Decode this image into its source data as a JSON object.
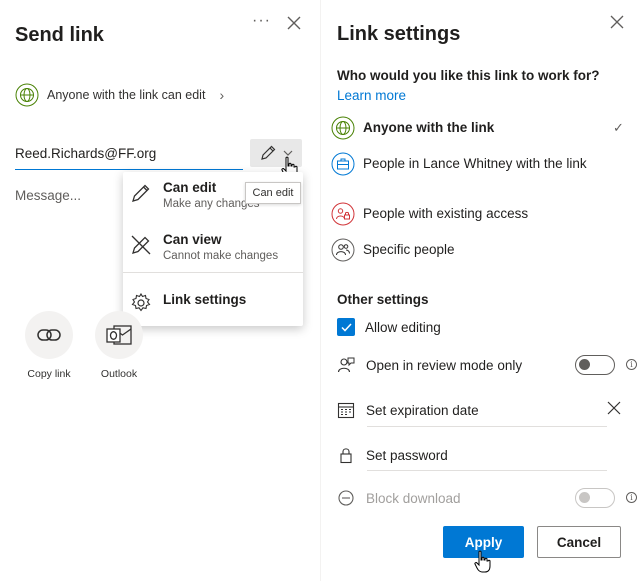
{
  "send_link": {
    "title": "Send link",
    "more_label": "···",
    "scope_text": "Anyone with the link can edit",
    "recipient": "Reed.Richards@FF.org",
    "message_placeholder": "Message...",
    "tooltip": "Can edit",
    "menu": [
      {
        "title": "Can edit",
        "subtitle": "Make any changes",
        "icon": "pencil-icon"
      },
      {
        "title": "Can view",
        "subtitle": "Cannot make changes",
        "icon": "no-edit-icon"
      },
      {
        "title": "Link settings",
        "icon": "gear-icon"
      }
    ],
    "share_apps": [
      {
        "label": "Copy link",
        "icon": "link-icon"
      },
      {
        "label": "Outlook",
        "icon": "outlook-icon"
      }
    ]
  },
  "link_settings": {
    "title": "Link settings",
    "question": "Who would you like this link to work for?",
    "learn_more": "Learn more",
    "options": [
      {
        "label": "Anyone with the link",
        "selected": true,
        "icon": "globe-icon",
        "check": "✓"
      },
      {
        "label": "People in Lance Whitney with the link",
        "selected": false,
        "icon": "briefcase-icon"
      },
      {
        "label": "People with existing access",
        "selected": false,
        "icon": "people-lock-icon"
      },
      {
        "label": "Specific people",
        "selected": false,
        "icon": "people-icon"
      }
    ],
    "other_heading": "Other settings",
    "allow_editing": {
      "label": "Allow editing",
      "checked": true
    },
    "review_mode": {
      "label": "Open in review mode only",
      "on": false
    },
    "expiration": {
      "placeholder": "Set expiration date"
    },
    "password": {
      "placeholder": "Set password"
    },
    "block_download": {
      "label": "Block download",
      "on": false,
      "disabled": true
    },
    "apply_label": "Apply",
    "cancel_label": "Cancel"
  },
  "colors": {
    "accent": "#0078d4",
    "text": "#201f1e",
    "muted": "#605e5c",
    "disabled": "#a19f9d"
  }
}
